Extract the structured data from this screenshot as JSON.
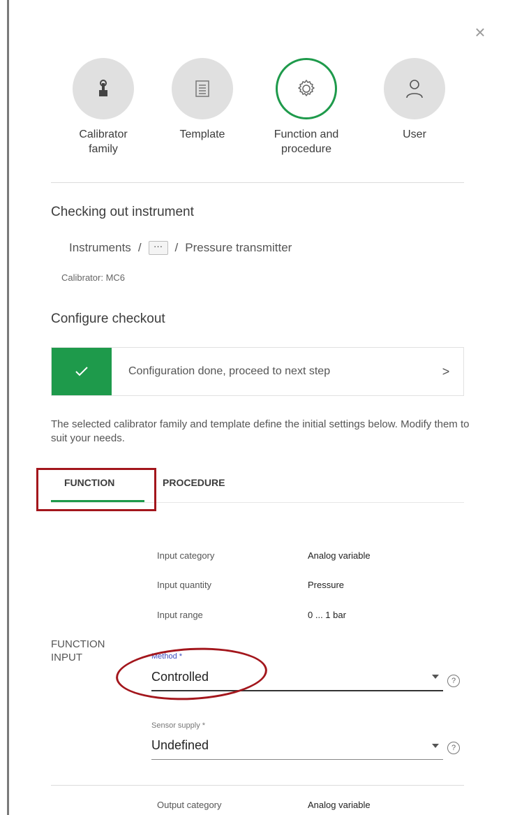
{
  "stepper": {
    "steps": [
      {
        "label": "Calibrator family",
        "icon": "touch-hand-icon",
        "active": false
      },
      {
        "label": "Template",
        "icon": "document-icon",
        "active": false
      },
      {
        "label": "Function and procedure",
        "icon": "gear-icon",
        "active": true
      },
      {
        "label": "User",
        "icon": "user-icon",
        "active": false
      }
    ]
  },
  "heading": "Checking out instrument",
  "breadcrumb": {
    "root": "Instruments",
    "separator": "/",
    "ellipsis": "···",
    "current": "Pressure transmitter"
  },
  "calibrator": "Calibrator: MC6",
  "configure_heading": "Configure checkout",
  "banner": {
    "text": "Configuration done, proceed to next step",
    "chevron": ">"
  },
  "description": "The selected calibrator family and template define the initial settings below. Modify them to suit your needs.",
  "tabs": [
    {
      "label": "FUNCTION",
      "active": true
    },
    {
      "label": "PROCEDURE",
      "active": false
    }
  ],
  "function_input": {
    "section_label": "FUNCTION INPUT",
    "rows": [
      {
        "label": "Input category",
        "value": "Analog variable"
      },
      {
        "label": "Input quantity",
        "value": "Pressure"
      },
      {
        "label": "Input range",
        "value": "0 ... 1 bar"
      }
    ],
    "method": {
      "label": "Method *",
      "value": "Controlled"
    },
    "sensor_supply": {
      "label": "Sensor supply *",
      "value": "Undefined"
    }
  },
  "output": {
    "rows": [
      {
        "label": "Output category",
        "value": "Analog variable"
      }
    ]
  },
  "icons": {
    "close": "×",
    "help": "?"
  },
  "colors": {
    "accent": "#1e9a4b",
    "highlight": "#a3161c",
    "method_label": "#3b4bbf"
  }
}
